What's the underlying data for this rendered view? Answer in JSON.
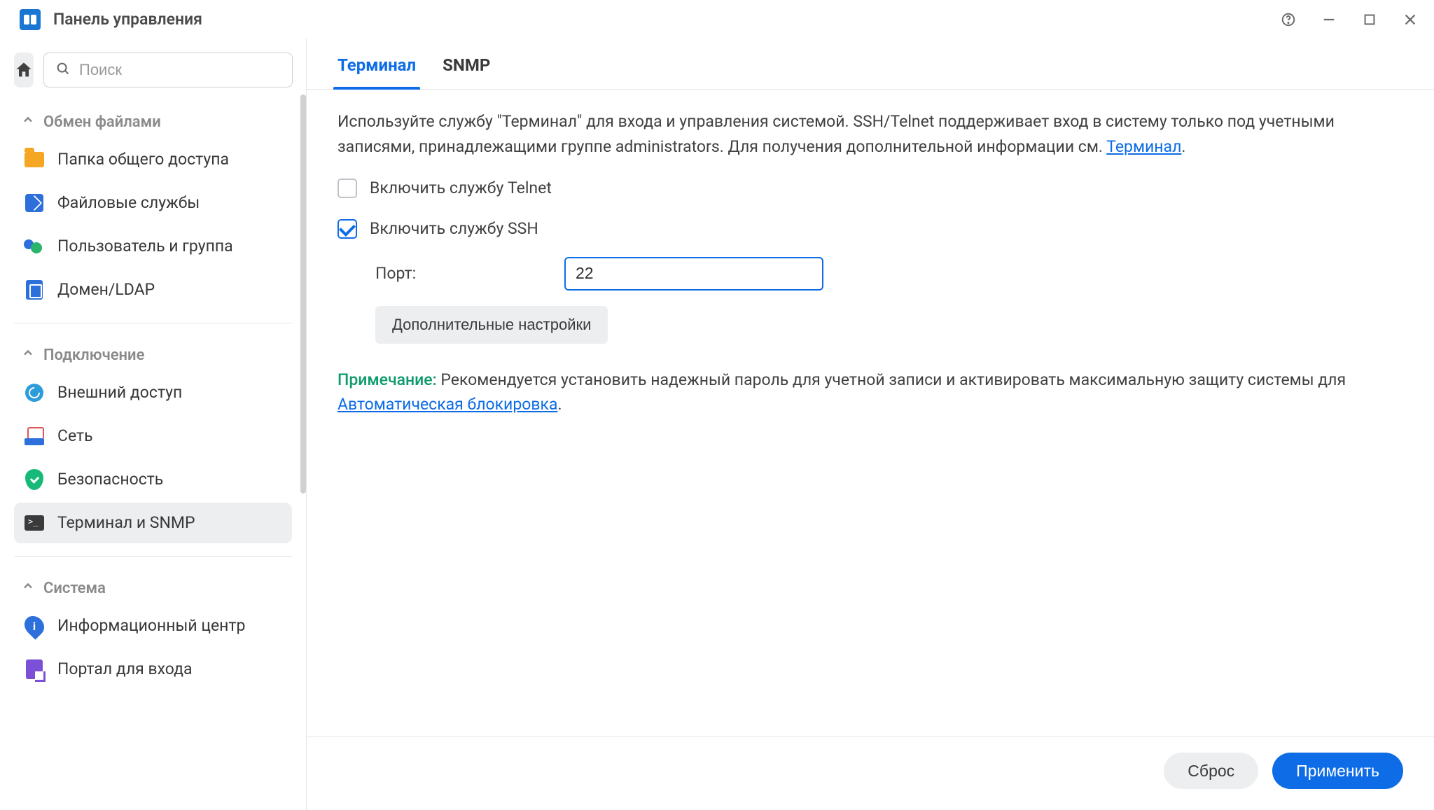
{
  "window": {
    "title": "Панель управления"
  },
  "sidebar": {
    "search_placeholder": "Поиск",
    "sections": [
      {
        "id": "file_sharing",
        "title": "Обмен файлами",
        "items": [
          {
            "id": "shared_folder",
            "label": "Папка общего доступа"
          },
          {
            "id": "file_services",
            "label": "Файловые службы"
          },
          {
            "id": "user_group",
            "label": "Пользователь и группа"
          },
          {
            "id": "domain_ldap",
            "label": "Домен/LDAP"
          }
        ]
      },
      {
        "id": "connectivity",
        "title": "Подключение",
        "items": [
          {
            "id": "external_access",
            "label": "Внешний доступ"
          },
          {
            "id": "network",
            "label": "Сеть"
          },
          {
            "id": "security",
            "label": "Безопасность"
          },
          {
            "id": "terminal_snmp",
            "label": "Терминал и SNMP",
            "active": true
          }
        ]
      },
      {
        "id": "system",
        "title": "Система",
        "items": [
          {
            "id": "info_center",
            "label": "Информационный центр"
          },
          {
            "id": "login_portal",
            "label": "Портал для входа"
          }
        ]
      }
    ]
  },
  "tabs": [
    {
      "id": "terminal",
      "label": "Терминал",
      "active": true
    },
    {
      "id": "snmp",
      "label": "SNMP"
    }
  ],
  "terminal": {
    "desc_prefix": "Используйте службу \"Терминал\" для входа и управления системой. SSH/Telnet поддерживает вход в систему только под учетными записями, принадлежащими группе administrators. Для получения дополнительной информации см. ",
    "desc_link": "Терминал",
    "desc_suffix": ".",
    "enable_telnet_label": "Включить службу Telnet",
    "enable_ssh_label": "Включить службу SSH",
    "telnet_checked": false,
    "ssh_checked": true,
    "port_label": "Порт:",
    "port_value": "22",
    "advanced_button": "Дополнительные настройки",
    "note_label": "Примечание:",
    "note_text_prefix": " Рекомендуется установить надежный пароль для учетной записи и активировать максимальную защиту системы для ",
    "note_link": "Автоматическая блокировка",
    "note_text_suffix": "."
  },
  "footer": {
    "reset": "Сброс",
    "apply": "Применить"
  }
}
